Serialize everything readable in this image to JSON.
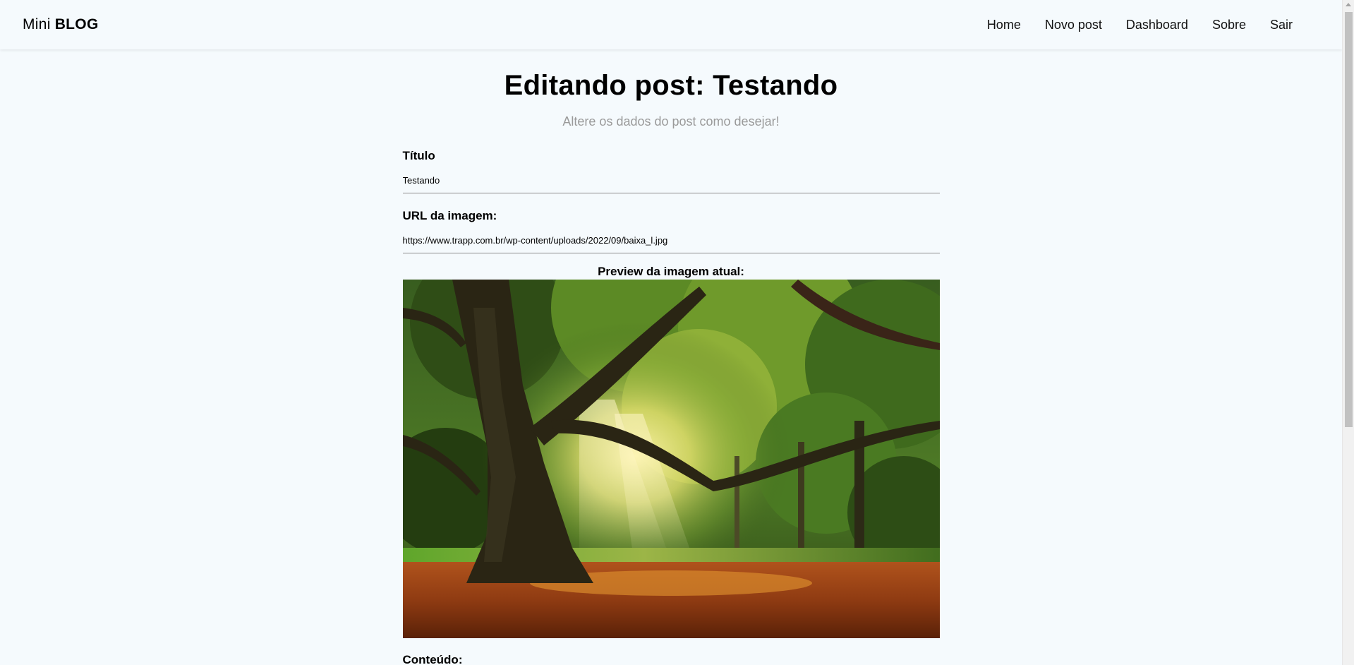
{
  "navbar": {
    "brand_light": "Mini",
    "brand_bold": "BLOG",
    "links": [
      {
        "label": "Home"
      },
      {
        "label": "Novo post"
      },
      {
        "label": "Dashboard"
      },
      {
        "label": "Sobre"
      },
      {
        "label": "Sair"
      }
    ]
  },
  "main": {
    "title": "Editando post: Testando",
    "subtitle": "Altere os dados do post como desejar!"
  },
  "form": {
    "title_label": "Título",
    "title_value": "Testando",
    "image_url_label": "URL da imagem:",
    "image_url_value": "https://www.trapp.com.br/wp-content/uploads/2022/09/baixa_l.jpg",
    "preview_label": "Preview da imagem atual:",
    "preview_image": "forest-tree-sunlight-image",
    "content_label": "Conteúdo:"
  },
  "colors": {
    "background": "#f5fafd",
    "subtitle": "#9a9a9a",
    "input_underline": "#8c8c8c"
  }
}
